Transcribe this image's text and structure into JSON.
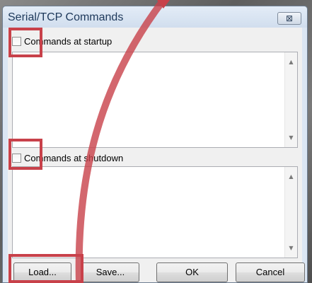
{
  "dialog": {
    "title": "Serial/TCP Commands",
    "close_glyph": "⊠"
  },
  "startup": {
    "checkbox_label": "Commands at startup",
    "checked": false,
    "value": ""
  },
  "shutdown": {
    "checkbox_label": "Commands at shutdown",
    "checked": false,
    "value": ""
  },
  "buttons": {
    "load": "Load...",
    "save": "Save...",
    "ok": "OK",
    "cancel": "Cancel"
  },
  "scroll": {
    "up_glyph": "▲",
    "down_glyph": "▼"
  },
  "colors": {
    "highlight": "#c8414a",
    "title_text": "#1e395b",
    "window_frame": "#dbe6f3"
  },
  "icons": [
    "close-icon",
    "scroll-up-arrow-icon",
    "scroll-down-arrow-icon",
    "annotation-arc"
  ]
}
